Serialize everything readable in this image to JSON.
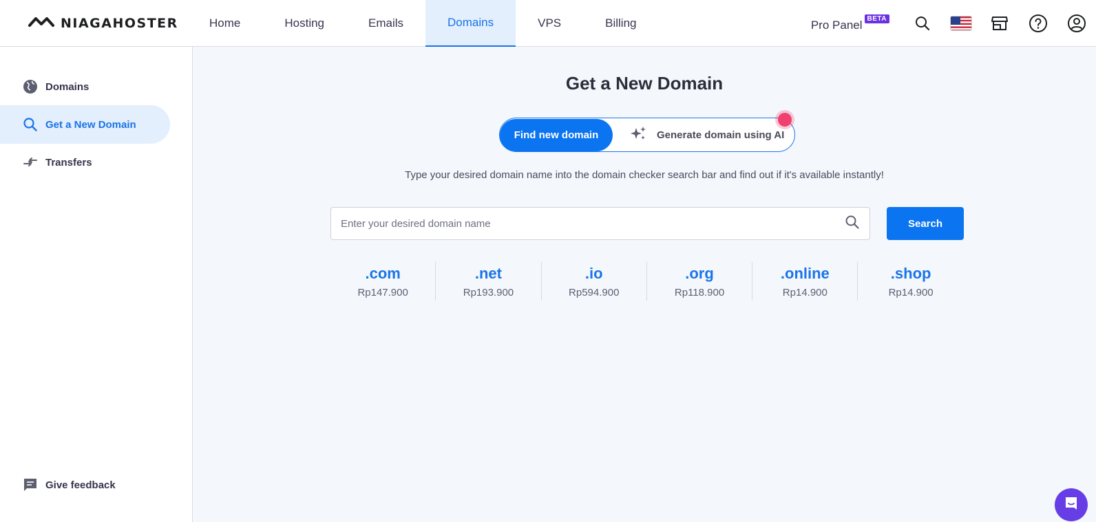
{
  "brand": {
    "name": "NIAGAHOSTER",
    "logo_icon": "infinity-logo-icon"
  },
  "nav": {
    "items": [
      {
        "label": "Home",
        "active": false
      },
      {
        "label": "Hosting",
        "active": false
      },
      {
        "label": "Emails",
        "active": false
      },
      {
        "label": "Domains",
        "active": true
      },
      {
        "label": "VPS",
        "active": false
      },
      {
        "label": "Billing",
        "active": false
      }
    ]
  },
  "top_right": {
    "pro_panel_label": "Pro Panel",
    "beta_badge": "BETA",
    "icons": [
      "search-icon",
      "us-flag-icon",
      "store-icon",
      "help-icon",
      "account-icon"
    ]
  },
  "sidebar": {
    "items": [
      {
        "label": "Domains",
        "icon": "globe-icon",
        "active": false
      },
      {
        "label": "Get a New Domain",
        "icon": "search-icon",
        "active": true
      },
      {
        "label": "Transfers",
        "icon": "transfer-arrows-icon",
        "active": false
      }
    ],
    "feedback_label": "Give feedback"
  },
  "main": {
    "title": "Get a New Domain",
    "toggle": {
      "find_label": "Find new domain",
      "ai_label": "Generate domain using AI"
    },
    "description": "Type your desired domain name into the domain checker search bar and find out if it's available instantly!",
    "search": {
      "placeholder": "Enter your desired domain name",
      "value": "",
      "button_label": "Search"
    },
    "tlds": [
      {
        "name": ".com",
        "price": "Rp147.900"
      },
      {
        "name": ".net",
        "price": "Rp193.900"
      },
      {
        "name": ".io",
        "price": "Rp594.900"
      },
      {
        "name": ".org",
        "price": "Rp118.900"
      },
      {
        "name": ".online",
        "price": "Rp14.900"
      },
      {
        "name": ".shop",
        "price": "Rp14.900"
      }
    ]
  },
  "colors": {
    "accent": "#0b74f0",
    "active_bg": "#e3effd",
    "beta": "#6b30e3",
    "notification_dot": "#f0406f",
    "chat": "#673de6"
  }
}
